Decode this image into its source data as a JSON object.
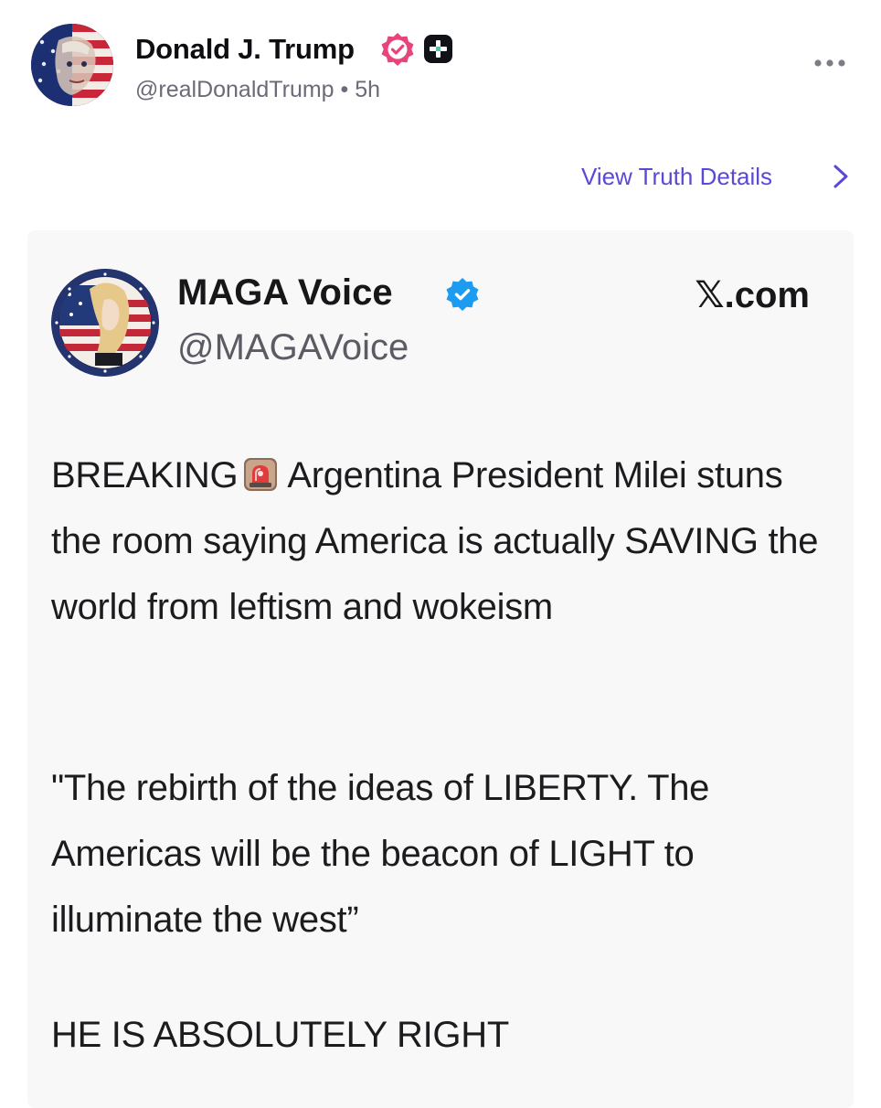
{
  "post": {
    "author_name": "Donald J. Trump",
    "author_handle": "@realDonaldTrump",
    "separator": "•",
    "time_ago": "5h",
    "more_icon": "ellipsis-icon",
    "verified_icon": "verified-badge-icon",
    "plus_icon": "plus-badge-icon"
  },
  "view_details": {
    "label": "View Truth Details",
    "icon": "chevron-right-icon",
    "color": "#5a49d6"
  },
  "embed": {
    "author_name": "MAGA Voice",
    "author_handle": "@MAGAVoice",
    "source": "𝕏.com",
    "paragraphs": [
      {
        "before_icon": "BREAKING",
        "icon": "siren-icon",
        "after_icon": "Argentina President Milei stuns the room saying America is actually SAVING the world from leftism and wokeism"
      },
      {
        "text": "\"The rebirth of the ideas of LIBERTY. The Americas will be the beacon of LIGHT to illuminate the west”"
      },
      {
        "text": "HE IS ABSOLUTELY RIGHT"
      }
    ]
  },
  "colors": {
    "accent": "#5a49d6",
    "verified_pink": "#e8447c",
    "verified_blue": "#1d9bf0",
    "card_bg": "#f8f8f9",
    "handle_gray": "#6b6b78"
  }
}
